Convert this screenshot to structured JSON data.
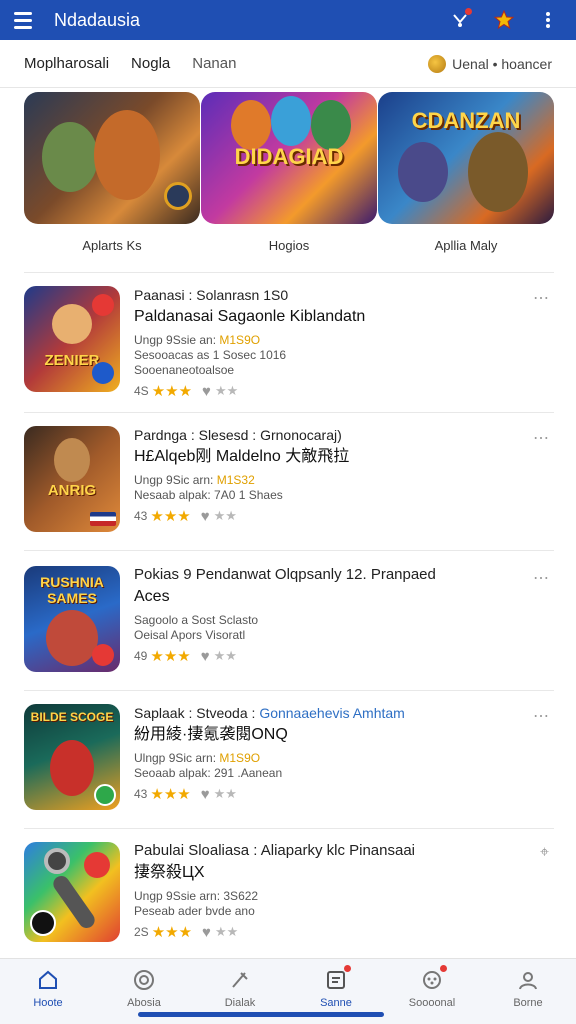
{
  "app_bar": {
    "title": "Ndadausia",
    "icons": [
      "menu-icon",
      "notification-icon",
      "star-icon",
      "more-vert-icon"
    ]
  },
  "tabs": {
    "items": [
      "Moplharosali",
      "Nogla",
      "Nanan"
    ],
    "right_label": "Uenal • hoancer"
  },
  "featured": [
    {
      "caption": "Aplarts Ks"
    },
    {
      "caption": "Hogios",
      "art_text": "DIDAGIAD"
    },
    {
      "caption": "Apllia Maly",
      "art_text": "CDANZAN"
    }
  ],
  "list": [
    {
      "line1": "Paanasi : Solanrasn 1S0",
      "line2": "Paldanasai Sagaonle Kiblandatn",
      "line3_prefix": "Ungp 9Ssie an: ",
      "price": "M1S9O",
      "line4a": "Sesooacas as 1 Sosec 1016",
      "line4b": "Sooenaneotoalsoe",
      "rating_num": "4S",
      "thumb_text": "ZENIER"
    },
    {
      "line1": "Pardnga : Slesesd : Grnonocaraj)",
      "line2": "H£Alqeb刚 Maldelno 大敵飛拉",
      "line3_prefix": "Ungp 9Sic arn: ",
      "price": "M1S32",
      "line4a": "Nesaab alpak: 7A0 1 Shaes",
      "line4b": "",
      "rating_num": "43",
      "thumb_text": "ANRIG"
    },
    {
      "line1": "Pokias 9 Pendanwat Olqpsanly 12. Pranpaed",
      "line2": "Aces",
      "line3_prefix": "Sagoolo a Sost Sclasto",
      "price": "",
      "line4a": "Oeisal Apors Visoratl",
      "line4b": "",
      "rating_num": "49",
      "thumb_text": "RUSHNIA SAMES"
    },
    {
      "line1_prefix": "Saplaak : Stveoda : ",
      "line1_link": "Gonnaaehevis Amhtam",
      "line2": "紛用綾·捿氪袭閱ONQ",
      "line3_prefix": "Ulngp 9Sic arn: ",
      "price": "M1S9O",
      "line4a": "Seoaab alpak: 291 .Aanean",
      "line4b": "",
      "rating_num": "43",
      "thumb_text": "BILDE SCOGE"
    },
    {
      "line1": "Pabulai Sloaliasa : Aliaparky klc Pinansaai",
      "line2": "捿祭殺ЦХ",
      "line3_prefix": "Ungp 9Ssie arn: 3S622",
      "price": "",
      "line4a": "Peseab ader bvde ano",
      "line4b": "",
      "rating_num": "2S",
      "thumb_text": ""
    }
  ],
  "bottom_nav": [
    {
      "label": "Hoote",
      "icon": "home-icon",
      "active": true
    },
    {
      "label": "Abosia",
      "icon": "target-icon",
      "active": false
    },
    {
      "label": "Dialak",
      "icon": "brush-icon",
      "active": false
    },
    {
      "label": "Sanne",
      "icon": "news-icon",
      "active": true
    },
    {
      "label": "Soooonal",
      "icon": "game-icon",
      "active": false
    },
    {
      "label": "Borne",
      "icon": "profile-icon",
      "active": false
    }
  ],
  "colors": {
    "primary": "#1f4fb3",
    "star": "#f2a900",
    "price": "#e0a000",
    "link": "#2e6fc4"
  }
}
